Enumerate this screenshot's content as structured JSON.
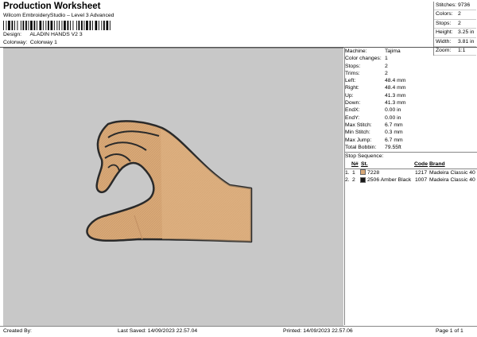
{
  "header": {
    "title": "Production Worksheet",
    "subtitle": "Wilcom EmbroideryStudio – Level 3 Advanced",
    "design_label": "Design:",
    "design_value": "ALADIN HANDS V2 3",
    "colorway_label": "Colorway:",
    "colorway_value": "Colorway 1"
  },
  "stats": [
    {
      "label": "Stitches:",
      "value": "9736"
    },
    {
      "label": "Colors:",
      "value": "2"
    },
    {
      "label": "Stops:",
      "value": "2"
    },
    {
      "label": "Height:",
      "value": "3.25 in"
    },
    {
      "label": "Width:",
      "value": "3.81 in"
    },
    {
      "label": "Zoom:",
      "value": "1:1"
    }
  ],
  "properties": [
    {
      "label": "Machine:",
      "value": "Tajima"
    },
    {
      "label": "Color changes:",
      "value": "1"
    },
    {
      "label": "Stops:",
      "value": "2"
    },
    {
      "label": "Trims:",
      "value": "2"
    },
    {
      "label": "Left:",
      "value": "48.4 mm"
    },
    {
      "label": "Right:",
      "value": "48.4 mm"
    },
    {
      "label": "Up:",
      "value": "41.3 mm"
    },
    {
      "label": "Down:",
      "value": "41.3 mm"
    },
    {
      "label": "EndX:",
      "value": "0.00 in"
    },
    {
      "label": "EndY:",
      "value": "0.00 in"
    },
    {
      "label": "Max Stitch:",
      "value": "6.7 mm"
    },
    {
      "label": "Min Stitch:",
      "value": "0.3 mm"
    },
    {
      "label": "Max Jump:",
      "value": "6.7 mm"
    },
    {
      "label": "Total Bobbin:",
      "value": "79.55ft"
    }
  ],
  "stop_sequence": {
    "title": "Stop Sequence:",
    "columns": [
      "N#",
      "St.",
      "Code",
      "Brand"
    ],
    "rows": [
      {
        "index": "1.",
        "n": "1",
        "color_code": "7228",
        "color_name": "",
        "st": "1217",
        "brand": "Madeira Classic 40",
        "swatch": "#d8a878"
      },
      {
        "index": "2.",
        "n": "2",
        "color_code": "2506",
        "color_name": "Amber Black",
        "st": "1007",
        "brand": "Madeira Classic 40",
        "swatch": "#1a1a1a"
      }
    ]
  },
  "colors": {
    "canvas_bg": "#c8c8c8",
    "skin": "#d8a878",
    "outline": "#2a2a2a"
  },
  "footer": {
    "created_by": "Created By:",
    "last_saved": "Last Saved: 14/09/2023 22.57.04",
    "printed": "Printed: 14/09/2023 22.57.06",
    "page": "Page 1 of 1"
  }
}
